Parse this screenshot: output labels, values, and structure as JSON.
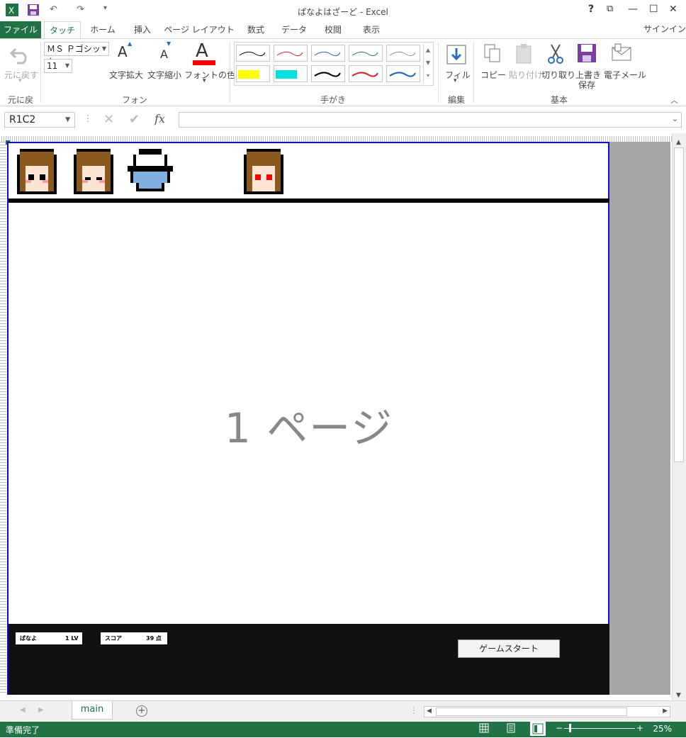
{
  "window": {
    "title": "ぱなよはざーど - Excel",
    "help": "?",
    "controls": [
      "?",
      "⧉",
      "—",
      "☐",
      "✕"
    ]
  },
  "quick_access": {
    "undo": "↶",
    "redo": "↷"
  },
  "ribbon_tabs": {
    "file": "ファイル",
    "items": [
      "タッチ",
      "ホーム",
      "挿入",
      "ページ レイアウト",
      "数式",
      "データ",
      "校閲",
      "表示"
    ],
    "active": "タッチ",
    "signin": "サインイン"
  },
  "ribbon": {
    "undo_label": "元に戻す",
    "undo_group": "元に戻す",
    "font_name": "ＭＳ Ｐゴシック",
    "font_size": "11",
    "grow_font": "文字拡大",
    "shrink_font": "文字縮小",
    "font_color": "フォントの色",
    "font_group": "フォント",
    "pen_group": "手がき",
    "fill_label": "フィル",
    "edit_group": "編集",
    "copy": "コピー",
    "paste": "貼り付け",
    "cut": "切り取り",
    "save_line1": "上書き",
    "save_line2": "保存",
    "email": "電子メール",
    "basic_group": "基本",
    "pen_colors": [
      "#000000",
      "#e02020",
      "#2060c0",
      "#208040",
      "#909090",
      "#ffff00",
      "#00e0e0",
      "#000000",
      "#e02020",
      "#2060c0"
    ]
  },
  "formula_bar": {
    "name_box": "R1C2",
    "fx": "fx",
    "formula": ""
  },
  "sheet": {
    "page_label": "1 ページ",
    "player_stat": {
      "name": "ぱなよ",
      "value": "1 LV"
    },
    "score_stat": {
      "name": "スコア",
      "value": "39 点"
    },
    "start_button": "ゲームスタート"
  },
  "sheet_tabs": {
    "active": "main",
    "add": "+"
  },
  "status": {
    "text": "準備完了",
    "zoom": "25%"
  },
  "colors": {
    "excel_green": "#217346",
    "page_border": "#1010c0",
    "hair": "#8b5a1e",
    "bowl": "#7fb0e0"
  }
}
